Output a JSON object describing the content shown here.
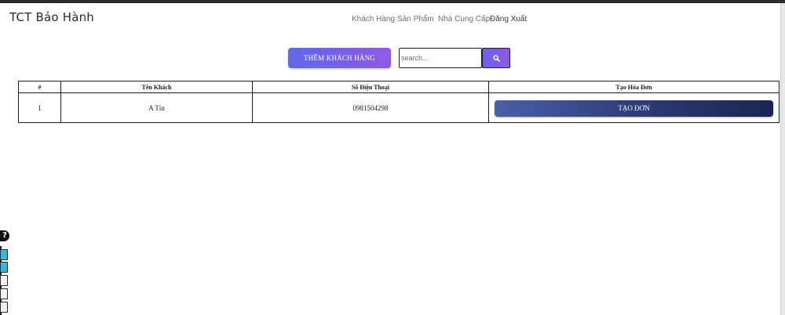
{
  "app": {
    "brand": "TCT Bảo Hành"
  },
  "nav": {
    "items": [
      {
        "label": "Khách Hàng"
      },
      {
        "label": "Sản Phẩm"
      },
      {
        "label": "Nhà Cung Cấp"
      },
      {
        "label": "Đăng Xuất"
      }
    ]
  },
  "toolbar": {
    "add_label": "THÊM KHÁCH HÀNG",
    "search_placeholder": "search...",
    "search_icon": "search-icon"
  },
  "table": {
    "headers": [
      "#",
      "Tên Khách",
      "Số Điện Thoại",
      "Tạo Hóa Đơn"
    ],
    "rows": [
      {
        "index": "1",
        "name": "A Tín",
        "phone": "0981504298",
        "action_label": "TẠO ĐƠN"
      }
    ]
  },
  "colors": {
    "add_button": [
      "#5f68e8",
      "#8f59e6"
    ],
    "create_button": [
      "#4a5fa8",
      "#1a2550"
    ],
    "text": "#1a1a1a"
  }
}
